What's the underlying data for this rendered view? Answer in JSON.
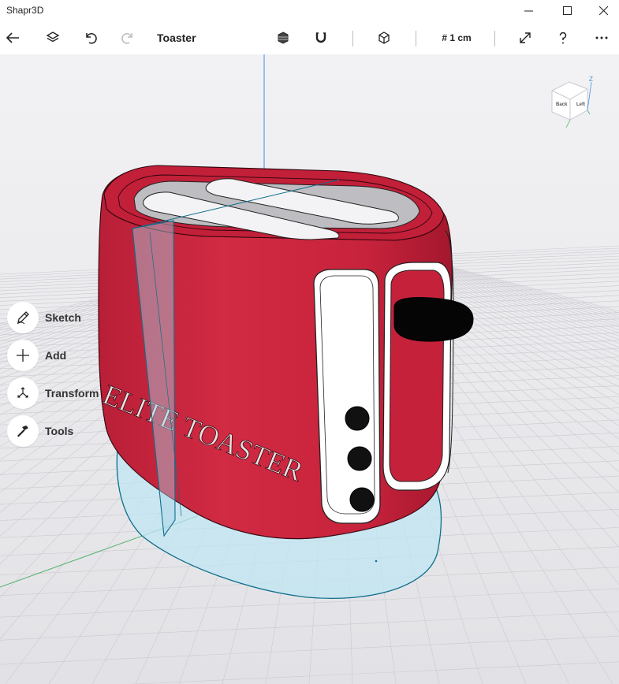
{
  "window": {
    "app_title": "Shapr3D",
    "controls": [
      "minimize-icon",
      "maximize-icon",
      "close-icon"
    ]
  },
  "toolbar": {
    "document_title": "Toaster",
    "grid_size": "# 1 cm",
    "icons": [
      "back-arrow-icon",
      "layers-icon",
      "undo-icon",
      "redo-icon",
      "shading-icon",
      "magnet-icon",
      "view-cube-icon",
      "expand-icon",
      "help-icon",
      "more-icon"
    ]
  },
  "view_cube": {
    "face_back": "Back",
    "face_left": "Left",
    "axis_z": "Z"
  },
  "side_tools": [
    {
      "label": "Sketch",
      "icon": "pencil-icon"
    },
    {
      "label": "Add",
      "icon": "plus-icon"
    },
    {
      "label": "Transform",
      "icon": "transform-arrows-icon"
    },
    {
      "label": "Tools",
      "icon": "hammer-icon"
    }
  ],
  "model": {
    "engraving": "ELITE TOASTER",
    "body_color": "#c5213b",
    "selection_color": "#0e6f8a"
  }
}
